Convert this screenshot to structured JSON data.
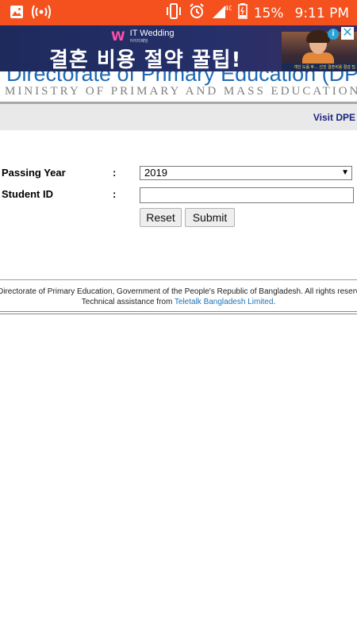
{
  "status_bar": {
    "battery": "15%",
    "time": "9:11 PM",
    "network": "4G",
    "icons": [
      "image-icon",
      "hotspot-icon",
      "vibrate-icon",
      "alarm-icon",
      "signal-icon",
      "battery-icon"
    ]
  },
  "ad": {
    "brand": "IT Wedding",
    "brand_sub": "아이티웨딩",
    "headline": "결혼 비용 절약 꿀팁!",
    "photo_caption": "개인 도움 후… 선진 결혼비용 절감 팁",
    "info_label": "i",
    "close_label": "✕",
    "colors": {
      "background": "#25306a",
      "logo_accent": "#ff4fa6"
    }
  },
  "header": {
    "title": "Directorate of Primary Education (DPE)",
    "subtitle": "MINISTRY OF PRIMARY AND MASS EDUCATION"
  },
  "nav": {
    "visit_link": "Visit DPE"
  },
  "form": {
    "passing_year_label": "Passing Year",
    "student_id_label": "Student ID",
    "colon": ":",
    "passing_year_value": "2019",
    "student_id_value": "",
    "reset_label": "Reset",
    "submit_label": "Submit"
  },
  "footer": {
    "copyright": "Directorate of Primary Education, Government of the People's Republic of Bangladesh. All rights reserved.",
    "assistance_prefix": "Technical assistance from ",
    "assistance_link": "Teletalk Bangladesh Limited",
    "assistance_suffix": "."
  },
  "colors": {
    "status_bar": "#f4511e",
    "title_blue": "#1c69b5",
    "link_navy": "#1a237e",
    "footer_link": "#1a73b8"
  }
}
